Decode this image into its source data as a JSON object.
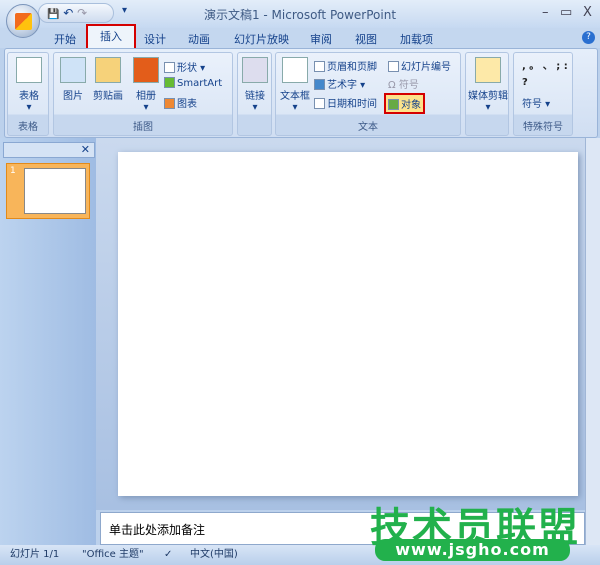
{
  "window": {
    "title": "演示文稿1 - Microsoft PowerPoint",
    "minimize": "–",
    "maximize": "▭",
    "close": "X"
  },
  "qat": {
    "save": "💾",
    "undo": "↶",
    "redo": "↷",
    "more": "▾"
  },
  "tabs": [
    "开始",
    "插入",
    "设计",
    "动画",
    "幻灯片放映",
    "审阅",
    "视图",
    "加载项"
  ],
  "active_tab": "插入",
  "help": "?",
  "ribbon": {
    "table": {
      "button": "表格",
      "group": "表格"
    },
    "illustrations": {
      "picture": "图片",
      "clipart": "剪贴画",
      "album": "相册",
      "shapes": "形状",
      "smartart": "SmartArt",
      "chart": "图表",
      "group": "插图"
    },
    "links": {
      "button": "链接",
      "group": ""
    },
    "text": {
      "textbox": "文本框",
      "header_footer": "页眉和页脚",
      "wordart": "艺术字",
      "datetime": "日期和时间",
      "slide_number": "幻灯片编号",
      "symbol": "符号",
      "object": "对象",
      "group": "文本"
    },
    "media": {
      "button": "媒体剪辑"
    },
    "special": {
      "chars": ", 。 、 ; : ?",
      "symbol": "符号",
      "group": "特殊符号"
    }
  },
  "slides_pane": {
    "slide_number": "1"
  },
  "notes": {
    "placeholder": "单击此处添加备注"
  },
  "status": {
    "slide": "幻灯片 1/1",
    "theme": "\"Office 主题\"",
    "language": "中文(中国)"
  },
  "watermark": {
    "text": "技术员联盟",
    "url": "www.jsgho.com"
  },
  "colors": {
    "highlight": "#d40000",
    "accent": "#15428b"
  }
}
